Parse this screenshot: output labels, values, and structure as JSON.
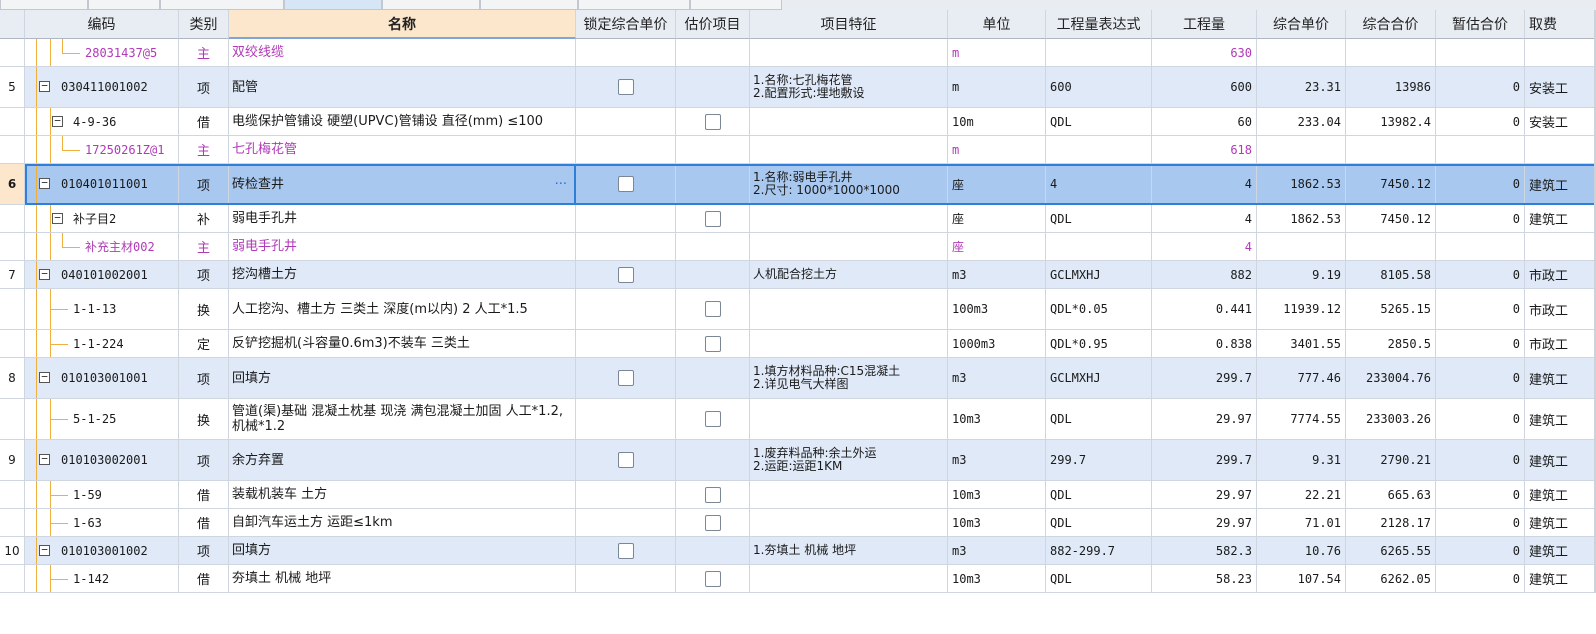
{
  "columns": {
    "code": "编码",
    "type": "类别",
    "name": "名称",
    "lock_price": "锁定综合单价",
    "est_item": "估价项目",
    "feature": "项目特征",
    "unit": "单位",
    "qty_expr": "工程量表达式",
    "qty": "工程量",
    "unit_price": "综合单价",
    "total": "综合合价",
    "est_total": "暂估合价",
    "fee": "取费"
  },
  "rows": [
    {
      "seq": "",
      "code": "28031437@5",
      "type": "主",
      "name": "双绞线缆",
      "feature": [],
      "unit": "m",
      "qty_expr": "",
      "qty": "630",
      "unit_price": "",
      "total": "",
      "est_total": "",
      "fee": "",
      "level": 2,
      "kind": "main",
      "checkbox": false
    },
    {
      "seq": "5",
      "code": "030411001002",
      "type": "项",
      "name": "配管",
      "feature": [
        "1.名称:七孔梅花管",
        "2.配置形式:埋地敷设"
      ],
      "unit": "m",
      "qty_expr": "600",
      "qty": "600",
      "unit_price": "23.31",
      "total": "13986",
      "est_total": "0",
      "fee": "安装工",
      "level": 0,
      "kind": "xiang",
      "checkbox": true
    },
    {
      "seq": "",
      "code": "4-9-36",
      "type": "借",
      "name": "电缆保护管铺设 硬塑(UPVC)管铺设 直径(mm) ≤100",
      "feature": [],
      "unit": "10m",
      "qty_expr": "QDL",
      "qty": "60",
      "unit_price": "233.04",
      "total": "13982.4",
      "est_total": "0",
      "fee": "安装工",
      "level": 1,
      "kind": "sub",
      "checkbox": true
    },
    {
      "seq": "",
      "code": "17250261Z@1",
      "type": "主",
      "name": "七孔梅花管",
      "feature": [],
      "unit": "m",
      "qty_expr": "",
      "qty": "618",
      "unit_price": "",
      "total": "",
      "est_total": "",
      "fee": "",
      "level": 2,
      "kind": "main",
      "checkbox": false
    },
    {
      "seq": "6",
      "code": "010401011001",
      "type": "项",
      "name": "砖检查井",
      "feature": [
        "1.名称:弱电手孔井",
        "2.尺寸: 1000*1000*1000"
      ],
      "unit": "座",
      "qty_expr": "4",
      "qty": "4",
      "unit_price": "1862.53",
      "total": "7450.12",
      "est_total": "0",
      "fee": "建筑工",
      "level": 0,
      "kind": "sel",
      "checkbox": true
    },
    {
      "seq": "",
      "code": "补子目2",
      "type": "补",
      "name": "弱电手孔井",
      "feature": [],
      "unit": "座",
      "qty_expr": "QDL",
      "qty": "4",
      "unit_price": "1862.53",
      "total": "7450.12",
      "est_total": "0",
      "fee": "建筑工",
      "level": 1,
      "kind": "sub",
      "checkbox": true
    },
    {
      "seq": "",
      "code": "补充主材002",
      "type": "主",
      "name": "弱电手孔井",
      "feature": [],
      "unit": "座",
      "qty_expr": "",
      "qty": "4",
      "unit_price": "",
      "total": "",
      "est_total": "",
      "fee": "",
      "level": 2,
      "kind": "main",
      "checkbox": false
    },
    {
      "seq": "7",
      "code": "040101002001",
      "type": "项",
      "name": "挖沟槽土方",
      "feature": [
        "人机配合挖土方"
      ],
      "unit": "m3",
      "qty_expr": "GCLMXHJ",
      "qty": "882",
      "unit_price": "9.19",
      "total": "8105.58",
      "est_total": "0",
      "fee": "市政工",
      "level": 0,
      "kind": "xiang",
      "checkbox": true
    },
    {
      "seq": "",
      "code": "1-1-13",
      "type": "换",
      "name": "人工挖沟、槽土方 三类土 深度(m以内) 2  人工*1.5",
      "feature": [],
      "unit": "100m3",
      "qty_expr": "QDL*0.05",
      "qty": "0.441",
      "unit_price": "11939.12",
      "total": "5265.15",
      "est_total": "0",
      "fee": "市政工",
      "level": 1,
      "kind": "leaf",
      "checkbox": true
    },
    {
      "seq": "",
      "code": "1-1-224",
      "type": "定",
      "name": "反铲挖掘机(斗容量0.6m3)不装车 三类土",
      "feature": [],
      "unit": "1000m3",
      "qty_expr": "QDL*0.95",
      "qty": "0.838",
      "unit_price": "3401.55",
      "total": "2850.5",
      "est_total": "0",
      "fee": "市政工",
      "level": 1,
      "kind": "leaf",
      "checkbox": true
    },
    {
      "seq": "8",
      "code": "010103001001",
      "type": "项",
      "name": "回填方",
      "feature": [
        "1.填方材料品种:C15混凝土",
        "2.详见电气大样图"
      ],
      "unit": "m3",
      "qty_expr": "GCLMXHJ",
      "qty": "299.7",
      "unit_price": "777.46",
      "total": "233004.76",
      "est_total": "0",
      "fee": "建筑工",
      "level": 0,
      "kind": "xiang",
      "checkbox": true
    },
    {
      "seq": "",
      "code": "5-1-25",
      "type": "换",
      "name": "管道(渠)基础 混凝土枕基 现浇  满包混凝土加固 人工*1.2,机械*1.2",
      "feature": [],
      "unit": "10m3",
      "qty_expr": "QDL",
      "qty": "29.97",
      "unit_price": "7774.55",
      "total": "233003.26",
      "est_total": "0",
      "fee": "建筑工",
      "level": 1,
      "kind": "leaf",
      "checkbox": true
    },
    {
      "seq": "9",
      "code": "010103002001",
      "type": "项",
      "name": "余方弃置",
      "feature": [
        "1.废弃料品种:余土外运",
        "2.运距:运距1KM"
      ],
      "unit": "m3",
      "qty_expr": "299.7",
      "qty": "299.7",
      "unit_price": "9.31",
      "total": "2790.21",
      "est_total": "0",
      "fee": "建筑工",
      "level": 0,
      "kind": "xiang",
      "checkbox": true
    },
    {
      "seq": "",
      "code": "1-59",
      "type": "借",
      "name": "装载机装车 土方",
      "feature": [],
      "unit": "10m3",
      "qty_expr": "QDL",
      "qty": "29.97",
      "unit_price": "22.21",
      "total": "665.63",
      "est_total": "0",
      "fee": "建筑工",
      "level": 1,
      "kind": "leaf",
      "checkbox": true
    },
    {
      "seq": "",
      "code": "1-63",
      "type": "借",
      "name": "自卸汽车运土方 运距≤1km",
      "feature": [],
      "unit": "10m3",
      "qty_expr": "QDL",
      "qty": "29.97",
      "unit_price": "71.01",
      "total": "2128.17",
      "est_total": "0",
      "fee": "建筑工",
      "level": 1,
      "kind": "leaf",
      "checkbox": true
    },
    {
      "seq": "10",
      "code": "010103001002",
      "type": "项",
      "name": "回填方",
      "feature": [
        "1.夯填土 机械 地坪"
      ],
      "unit": "m3",
      "qty_expr": "882-299.7",
      "qty": "582.3",
      "unit_price": "10.76",
      "total": "6265.55",
      "est_total": "0",
      "fee": "建筑工",
      "level": 0,
      "kind": "xiang",
      "checkbox": true
    },
    {
      "seq": "",
      "code": "1-142",
      "type": "借",
      "name": "夯填土 机械 地坪",
      "feature": [],
      "unit": "10m3",
      "qty_expr": "QDL",
      "qty": "58.23",
      "unit_price": "107.54",
      "total": "6262.05",
      "est_total": "0",
      "fee": "建筑工",
      "level": 1,
      "kind": "leaf",
      "checkbox": true
    }
  ],
  "icons": {
    "collapse": "minus-box-icon",
    "more": "ellipsis-icon",
    "checkbox": "checkbox-icon"
  },
  "colors": {
    "selected_row": "#a8c8ef",
    "item_row": "#dfe9f7",
    "main_material_text": "#b03ab8",
    "header_name": "#fde7cc",
    "tree_line": "#f0b040"
  }
}
